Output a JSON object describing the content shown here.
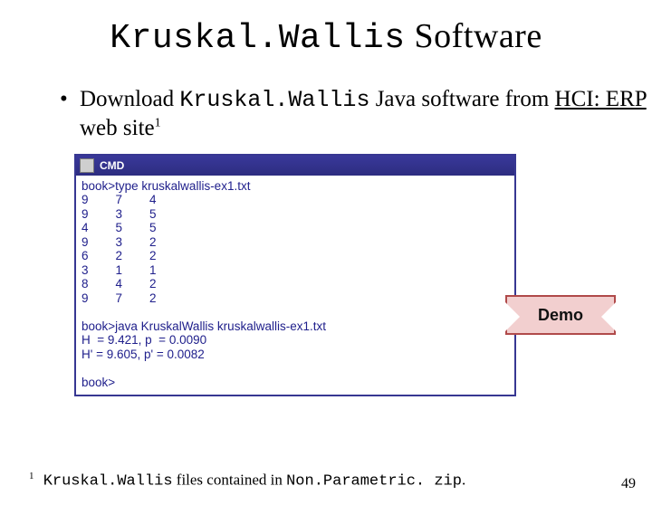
{
  "title": {
    "mono": "Kruskal.Wallis",
    "rest": " Software"
  },
  "bullet": {
    "lead": "Download ",
    "mono": "Kruskal.Wallis",
    "mid": " Java software from ",
    "link": "HCI: ERP",
    "tail": " web site",
    "sup": "1"
  },
  "terminal": {
    "window_title": "CMD",
    "lines": "book>type kruskalwallis-ex1.txt\n9        7        4\n9        3        5\n4        5        5\n9        3        2\n6        2        2\n3        1        1\n8        4        2\n9        7        2\n\nbook>java KruskalWallis kruskalwallis-ex1.txt\nH  = 9.421, p  = 0.0090\nH' = 9.605, p' = 0.0082\n\nbook>"
  },
  "demo_label": "Demo",
  "footnote": {
    "sup": "1",
    "mono1": " Kruskal.Wallis",
    "mid": " files contained in ",
    "mono2": "Non.Parametric. zip",
    "tail": "."
  },
  "page_number": "49"
}
